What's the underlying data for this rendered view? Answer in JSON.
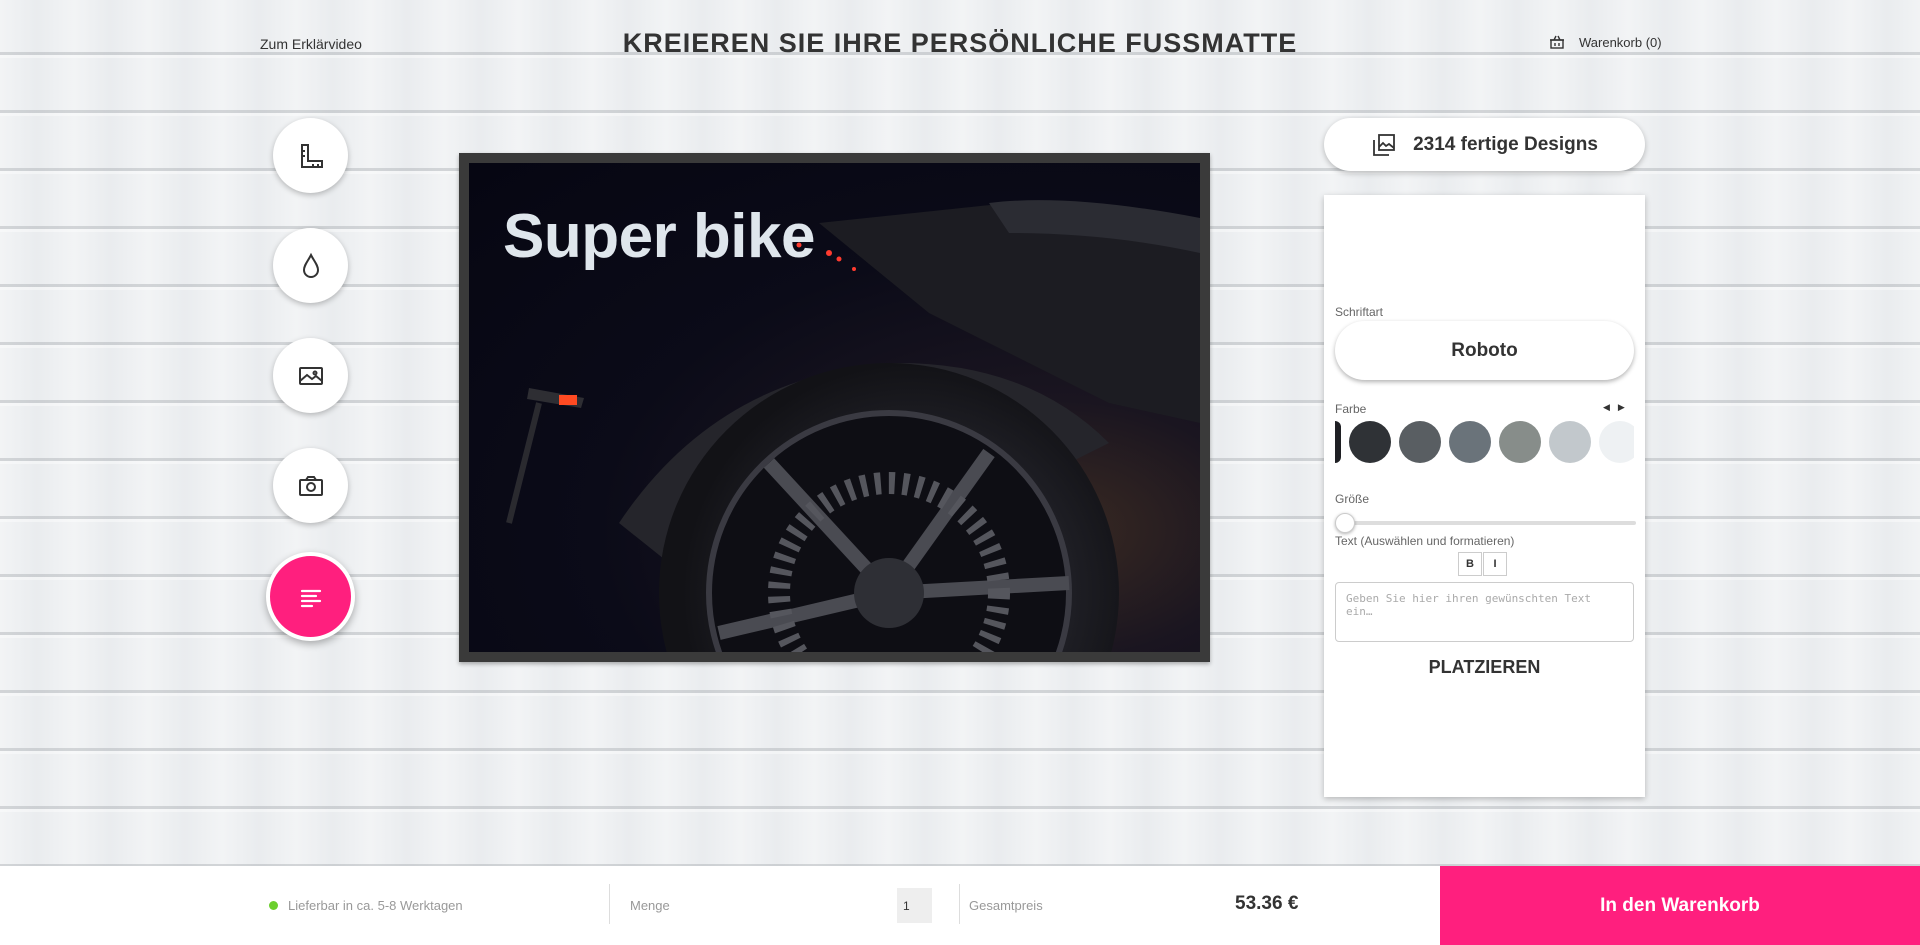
{
  "header": {
    "video_link": "Zum Erklärvideo",
    "title": "KREIEREN SIE IHRE PERSÖNLICHE FUSSMATTE",
    "cart_label": "Warenkorb (0)"
  },
  "tools": [
    {
      "icon": "ruler-icon"
    },
    {
      "icon": "drop-icon"
    },
    {
      "icon": "image-icon"
    },
    {
      "icon": "camera-icon"
    },
    {
      "icon": "text-align-icon",
      "active": true
    }
  ],
  "mat": {
    "text": "Super bike"
  },
  "panel": {
    "designs_label": "2314 fertige Designs",
    "font_label": "Schriftart",
    "font_value": "Roboto",
    "color_label": "Farbe",
    "colors": [
      "#2f3236",
      "#595e62",
      "#6a737a",
      "#878d8a",
      "#c2c8cc",
      "#eef1f3"
    ],
    "size_label": "Größe",
    "size_value": 0,
    "text_label": "Text (Auswählen und formatieren)",
    "bold_label": "B",
    "italic_label": "I",
    "text_placeholder": "Geben Sie hier ihren gewünschten Text ein…",
    "place_label": "PLATZIEREN"
  },
  "footer": {
    "delivery": "Lieferbar in ca. 5-8 Werktagen",
    "qty_label": "Menge",
    "qty_value": "1",
    "total_label": "Gesamtpreis",
    "total_value": "53.36 €",
    "add_to_cart": "In den Warenkorb"
  },
  "colors": {
    "accent": "#ff1f7e",
    "available": "#6ccf2e"
  }
}
